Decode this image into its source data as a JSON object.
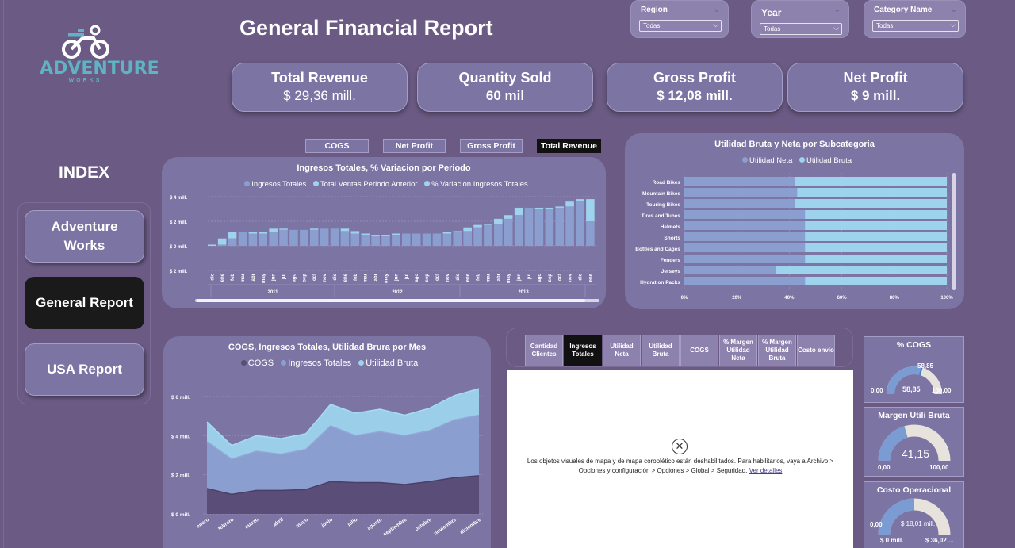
{
  "brand": {
    "logo_text": "ADVENTURE",
    "logo_sub": "WORKS"
  },
  "page_title": "General Financial Report",
  "slicers": [
    {
      "label": "Region",
      "value": "Todas"
    },
    {
      "label": "Year",
      "value": "Todas"
    },
    {
      "label": "Category Name",
      "value": "Todas"
    }
  ],
  "kpis": [
    {
      "title": "Total Revenue",
      "value": "$ 29,36 mill."
    },
    {
      "title": "Quantity Sold",
      "value": "60 mil"
    },
    {
      "title": "Gross Profit",
      "value": "$ 12,08 mill."
    },
    {
      "title": "Net Profit",
      "value": "$ 9 mill."
    }
  ],
  "index": {
    "title": "INDEX",
    "items": [
      "Adventure Works",
      "General Report",
      "USA Report"
    ],
    "active": "General Report"
  },
  "toggles": {
    "items": [
      "COGS",
      "Net Profit",
      "Gross Profit",
      "Total Revenue"
    ],
    "active": "Total Revenue"
  },
  "colors": {
    "bg": "#6a5a84",
    "panel": "#7c74a3",
    "dark_series": "#5a4d78",
    "mid_series": "#8a9fcf",
    "light_series": "#9dd3ec"
  },
  "chart_data": [
    {
      "type": "bar",
      "title": "Ingresos Totales, % Variacion por Periodo",
      "legend": [
        "Ingresos Totales",
        "Total Ventas Periodo Anterior",
        "% Variacion Ingresos Totales"
      ],
      "yticks": [
        "$ 4 mill.",
        "$ 2 mill.",
        "$ 0 mill.",
        "$ 2 mill."
      ],
      "ylim": [
        -2,
        4
      ],
      "year_labels": [
        "...",
        "2011",
        "2012",
        "2013",
        "..."
      ],
      "categories": [
        "dic",
        "ene",
        "feb",
        "mar",
        "abr",
        "may",
        "jun",
        "jul",
        "ago",
        "sep",
        "oct",
        "nov",
        "dic",
        "ene",
        "feb",
        "mar",
        "abr",
        "may",
        "jun",
        "jul",
        "ago",
        "sep",
        "oct",
        "nov",
        "dic",
        "ene",
        "feb",
        "mar",
        "abr",
        "may",
        "jun",
        "jul",
        "ago",
        "sep",
        "oct",
        "nov",
        "dic",
        "ene"
      ],
      "series": [
        {
          "name": "Ingresos Totales",
          "values": [
            0.1,
            0.6,
            1.1,
            1.1,
            1.0,
            1.1,
            1.4,
            1.3,
            1.3,
            1.3,
            1.4,
            1.4,
            1.4,
            1.2,
            1.0,
            0.9,
            0.8,
            0.9,
            1.0,
            1.0,
            1.0,
            1.0,
            1.0,
            1.1,
            1.2,
            1.5,
            1.7,
            1.8,
            2.2,
            2.5,
            3.1,
            3.1,
            3.0,
            3.1,
            3.2,
            3.6,
            3.8,
            2.0
          ]
        },
        {
          "name": "Total Ventas Periodo Anterior",
          "values": [
            0,
            0.1,
            0.6,
            1.1,
            1.1,
            1.0,
            1.1,
            1.4,
            1.3,
            1.3,
            1.3,
            1.4,
            1.4,
            1.4,
            1.2,
            1.0,
            0.9,
            0.8,
            0.9,
            1.0,
            1.0,
            1.0,
            1.0,
            1.0,
            1.1,
            1.2,
            1.5,
            1.7,
            1.8,
            2.2,
            2.5,
            3.1,
            3.1,
            3.0,
            3.1,
            3.2,
            3.6,
            3.8
          ]
        }
      ]
    },
    {
      "type": "bar",
      "title": "Utilidad Bruta y Neta por Subcategoria",
      "legend": [
        "Utilidad Neta",
        "Utilidad Bruta"
      ],
      "categories": [
        "Road Bikes",
        "Mountain Bikes",
        "Touring Bikes",
        "Tires and Tubes",
        "Helmets",
        "Shorts",
        "Bottles and Cages",
        "Fenders",
        "Jerseys",
        "Hydration Packs"
      ],
      "series": [
        {
          "name": "Utilidad Neta",
          "values": [
            42,
            43,
            42,
            46,
            46,
            46,
            46,
            46,
            35,
            46
          ]
        },
        {
          "name": "Utilidad Bruta",
          "values": [
            100,
            100,
            100,
            100,
            100,
            100,
            100,
            100,
            100,
            100
          ]
        }
      ],
      "xticks": [
        "0%",
        "20%",
        "40%",
        "60%",
        "80%",
        "100%"
      ],
      "xlim": [
        0,
        100
      ]
    },
    {
      "type": "area",
      "title": "COGS, Ingresos Totales, Utilidad Brura por Mes",
      "legend": [
        "COGS",
        "Ingresos Totales",
        "Utilidad Bruta"
      ],
      "categories": [
        "enero",
        "febrero",
        "marzo",
        "abril",
        "mayo",
        "junio",
        "julio",
        "agosto",
        "septiembre",
        "octubre",
        "noviembre",
        "diciembre"
      ],
      "yticks": [
        "$ 6 mill.",
        "$ 4 mill.",
        "$ 2 mill.",
        "$ 0 mill."
      ],
      "ylim": [
        0,
        6
      ],
      "series": [
        {
          "name": "COGS",
          "values": [
            1.3,
            1.0,
            1.2,
            1.2,
            1.25,
            1.65,
            1.6,
            1.6,
            1.5,
            1.65,
            1.85,
            1.95
          ]
        },
        {
          "name": "Utilidad Bruta",
          "values": [
            3.7,
            2.8,
            3.2,
            3.05,
            3.3,
            4.5,
            4.0,
            4.2,
            4.0,
            4.25,
            4.8,
            5.05
          ]
        },
        {
          "name": "Ingresos Totales",
          "values": [
            4.7,
            3.5,
            4.0,
            3.85,
            4.1,
            5.6,
            5.15,
            5.35,
            5.05,
            5.4,
            6.05,
            6.4
          ]
        }
      ]
    }
  ],
  "map_tabs": {
    "items": [
      "Cantidad Clientes",
      "Ingresos Totales",
      "Utilidad Neta",
      "Utilidad Bruta",
      "COGS",
      "% Margen Utilidad Neta",
      "% Margen Utilidad Bruta",
      "Costo envio"
    ],
    "active": "Ingresos Totales"
  },
  "map_message": {
    "text": "Los objetos visuales de mapa y de mapa coroplético están deshabilitados. Para habilitarlos, vaya a Archivo > Opciones y configuración > Opciones > Global > Seguridad.",
    "link": "Ver detalles"
  },
  "gauges": {
    "cogs": {
      "title": "% COGS",
      "value": "58,85",
      "target": "58,85",
      "min": "0,00",
      "max": "100,00",
      "fraction": 0.5885
    },
    "margen": {
      "title": "Margen Utili Bruta",
      "value": "41,15",
      "min": "0,00",
      "max": "100,00",
      "fraction": 0.4115
    },
    "costo": {
      "title": "Costo Operacional",
      "value": "$ 18,01 mill.",
      "min": "0,00",
      "min2": "$ 0 mill.",
      "max": "$ 36,02 ...",
      "fraction": 0.5
    }
  }
}
